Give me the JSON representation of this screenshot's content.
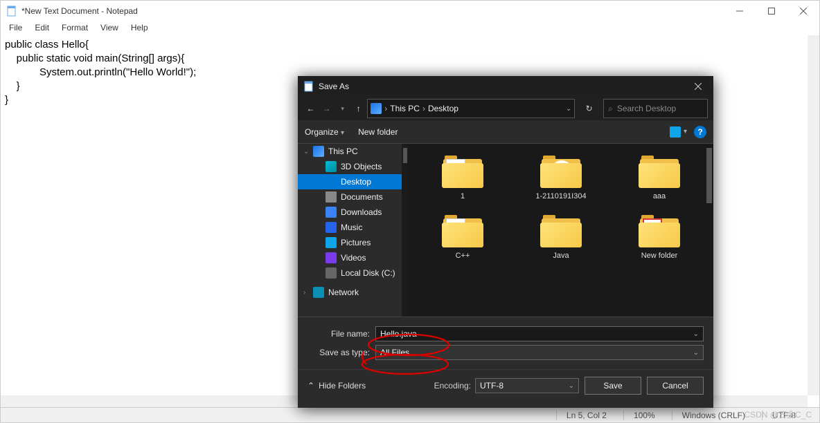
{
  "notepad": {
    "title": "*New Text Document - Notepad",
    "menu": {
      "file": "File",
      "edit": "Edit",
      "format": "Format",
      "view": "View",
      "help": "Help"
    },
    "code_l1": "public class Hello{",
    "code_l2": "    public static void main(String[] args){",
    "code_l3": "            System.out.println(\"Hello World!\");",
    "code_l4": "    }",
    "code_l5": "}",
    "status": {
      "pos": "Ln 5, Col 2",
      "zoom": "100%",
      "eol": "Windows (CRLF)",
      "enc": "UTF-8"
    }
  },
  "saveas": {
    "title": "Save As",
    "path": {
      "root": "This PC",
      "folder": "Desktop"
    },
    "search_placeholder": "Search Desktop",
    "toolbar": {
      "organize": "Organize",
      "newfolder": "New folder"
    },
    "tree": {
      "thispc": "This PC",
      "3d": "3D Objects",
      "desktop": "Desktop",
      "documents": "Documents",
      "downloads": "Downloads",
      "music": "Music",
      "pictures": "Pictures",
      "videos": "Videos",
      "localdisk": "Local Disk (C:)",
      "network": "Network"
    },
    "files": [
      {
        "name": "1"
      },
      {
        "name": "1-2110191I304"
      },
      {
        "name": "aaa"
      },
      {
        "name": "C++"
      },
      {
        "name": "Java"
      },
      {
        "name": "New folder"
      }
    ],
    "form": {
      "filename_lbl": "File name:",
      "filename_val": "Hello.java",
      "savetype_lbl": "Save as type:",
      "savetype_val": "All Files"
    },
    "footer": {
      "hide": "Hide Folders",
      "encoding_lbl": "Encoding:",
      "encoding_val": "UTF-8",
      "save": "Save",
      "cancel": "Cancel"
    }
  },
  "watermark": "CSDN @三金C_C"
}
